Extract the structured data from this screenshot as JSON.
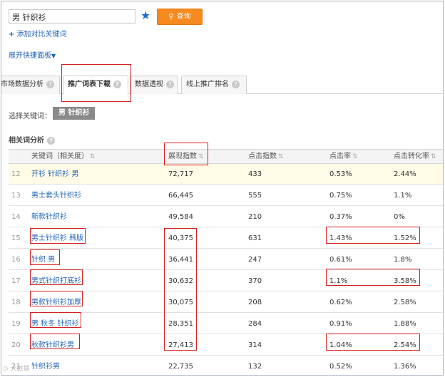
{
  "search": {
    "value": "男 针织衫",
    "star_icon": "star-icon",
    "button_label": "查询",
    "button_icon": "search-icon"
  },
  "add_compare": {
    "label": "添加对比关键词"
  },
  "expand_panel": {
    "label": "展开快捷面板"
  },
  "tabs": [
    {
      "label": "市场数据分析"
    },
    {
      "label": "推广词表下载"
    },
    {
      "label": "数据透视"
    },
    {
      "label": "线上推广排名"
    }
  ],
  "selected_keyword": {
    "label": "选择关键词：",
    "chip": "男 针织衫"
  },
  "section": {
    "title": "相关词分析"
  },
  "table": {
    "headers": [
      "关键词（相关度）",
      "展现指数",
      "点击指数",
      "点击率",
      "点击转化率"
    ],
    "rows": [
      {
        "idx": "12",
        "kw": "开衫 针织衫 男",
        "impr": "72,717",
        "clicks": "433",
        "ctr": "0.53%",
        "cvr": "2.44%"
      },
      {
        "idx": "13",
        "kw": "男士套头针织衫",
        "impr": "66,445",
        "clicks": "555",
        "ctr": "0.75%",
        "cvr": "1.1%"
      },
      {
        "idx": "14",
        "kw": "新款针织衫",
        "impr": "49,584",
        "clicks": "210",
        "ctr": "0.37%",
        "cvr": "0%"
      },
      {
        "idx": "15",
        "kw": "男士针织衫 韩版",
        "impr": "40,375",
        "clicks": "631",
        "ctr": "1.43%",
        "cvr": "1.52%"
      },
      {
        "idx": "16",
        "kw": "针织 男",
        "impr": "36,441",
        "clicks": "247",
        "ctr": "0.61%",
        "cvr": "1.8%"
      },
      {
        "idx": "17",
        "kw": "男式针织打底衫",
        "impr": "30,632",
        "clicks": "370",
        "ctr": "1.1%",
        "cvr": "3.58%"
      },
      {
        "idx": "18",
        "kw": "男款针织衫加厚",
        "impr": "30,075",
        "clicks": "208",
        "ctr": "0.62%",
        "cvr": "2.58%"
      },
      {
        "idx": "19",
        "kw": "男 秋冬 针织衫",
        "impr": "28,351",
        "clicks": "284",
        "ctr": "0.91%",
        "cvr": "1.88%"
      },
      {
        "idx": "20",
        "kw": "秋款针织衫男",
        "impr": "27,413",
        "clicks": "314",
        "ctr": "1.04%",
        "cvr": "2.54%"
      },
      {
        "idx": "21",
        "kw": "针织衫男",
        "impr": "22,735",
        "clicks": "132",
        "ctr": "0.52%",
        "cvr": "1.36%"
      }
    ]
  },
  "colors": {
    "accent": "#f68a1e",
    "link": "#1e63b8",
    "highlight_box": "#d42020"
  }
}
